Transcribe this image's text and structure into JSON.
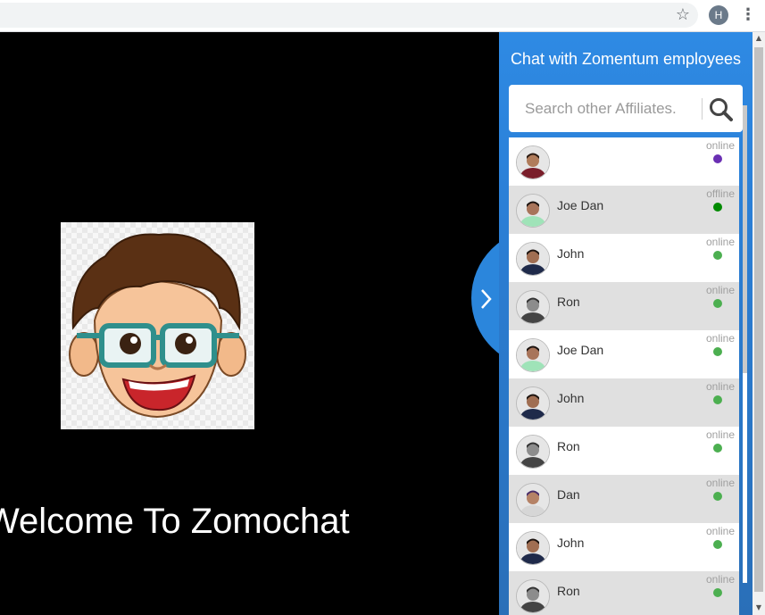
{
  "browser": {
    "star_icon": "★",
    "star_glyph": "☆",
    "profile_initial": "H",
    "menu_glyph": "⋮"
  },
  "main": {
    "welcome_text": "Welcome To Zomochat",
    "toggle_glyph": "›"
  },
  "chat": {
    "title": "Chat with Zomentum employees",
    "search_placeholder": "Search other Affiliates.",
    "users": [
      {
        "name": "",
        "status": "online",
        "dot": "#6a2fb3",
        "skin": "#b07c5b",
        "shirt": "#7a1e2a",
        "hair": "#2a1a12"
      },
      {
        "name": "Joe Dan",
        "status": "offline",
        "dot": "#008a00",
        "skin": "#a8745a",
        "shirt": "#9fe3b8",
        "hair": "#1c1410"
      },
      {
        "name": "John",
        "status": "online",
        "dot": "#4caf50",
        "skin": "#a06e52",
        "shirt": "#1f2a4a",
        "hair": "#1c1410"
      },
      {
        "name": "Ron",
        "status": "online",
        "dot": "#4caf50",
        "skin": "#8c8c8c",
        "shirt": "#444",
        "hair": "#333"
      },
      {
        "name": "Joe Dan",
        "status": "online",
        "dot": "#4caf50",
        "skin": "#a8745a",
        "shirt": "#9fe3b8",
        "hair": "#1c1410"
      },
      {
        "name": "John",
        "status": "online",
        "dot": "#4caf50",
        "skin": "#a06e52",
        "shirt": "#1f2a4a",
        "hair": "#1c1410"
      },
      {
        "name": "Ron",
        "status": "online",
        "dot": "#4caf50",
        "skin": "#8c8c8c",
        "shirt": "#444",
        "hair": "#333"
      },
      {
        "name": "Dan",
        "status": "online",
        "dot": "#4caf50",
        "skin": "#b58266",
        "shirt": "#d6d6d6",
        "hair": "#4a2f6a"
      },
      {
        "name": "John",
        "status": "online",
        "dot": "#4caf50",
        "skin": "#a06e52",
        "shirt": "#1f2a4a",
        "hair": "#1c1410"
      },
      {
        "name": "Ron",
        "status": "online",
        "dot": "#4caf50",
        "skin": "#8c8c8c",
        "shirt": "#444",
        "hair": "#333"
      }
    ]
  },
  "colors": {
    "accent": "#2b86dc",
    "online_dot": "#4caf50",
    "row_alt": "#e0e0e0"
  }
}
